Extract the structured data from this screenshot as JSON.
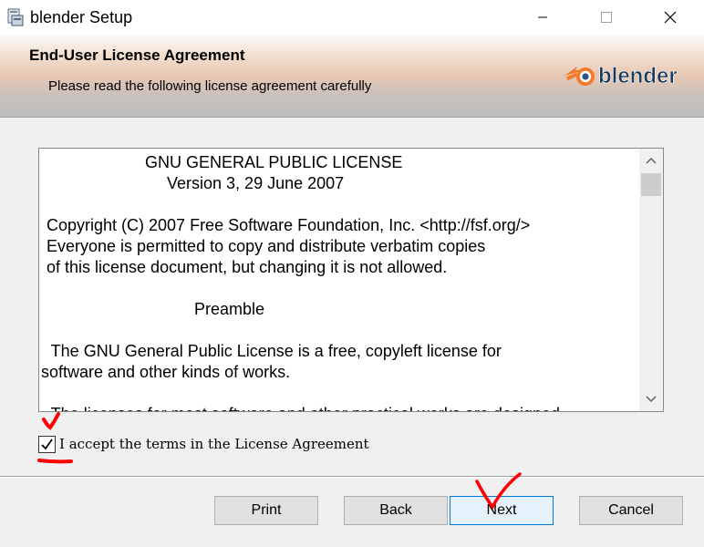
{
  "window": {
    "title": "blender Setup",
    "controls": [
      "minimize-icon",
      "maximize-icon",
      "close-icon"
    ]
  },
  "header": {
    "title": "End-User License Agreement",
    "subtitle": "Please read the following license agreement carefully",
    "logo_text": "blender",
    "logo_colors": {
      "orange": "#f5792a",
      "blue": "#265787"
    }
  },
  "license": {
    "lines": [
      "GNU GENERAL PUBLIC LICENSE",
      "Version 3, 29 June 2007",
      "Copyright (C) 2007 Free Software Foundation, Inc. <http://fsf.org/>",
      "Everyone is permitted to copy and distribute verbatim copies",
      "of this license document, but changing it is not allowed.",
      "Preamble",
      " The GNU General Public License is a free, copyleft license for",
      "software and other kinds of works.",
      " The licenses for most software and other practical works are designed"
    ]
  },
  "accept": {
    "label": "I accept the terms in the License Agreement",
    "checked": true
  },
  "buttons": {
    "print": "Print",
    "back": "Back",
    "next": "Next",
    "cancel": "Cancel"
  },
  "colors": {
    "annotation": "#ff0000",
    "primary_border": "#0078d7"
  }
}
